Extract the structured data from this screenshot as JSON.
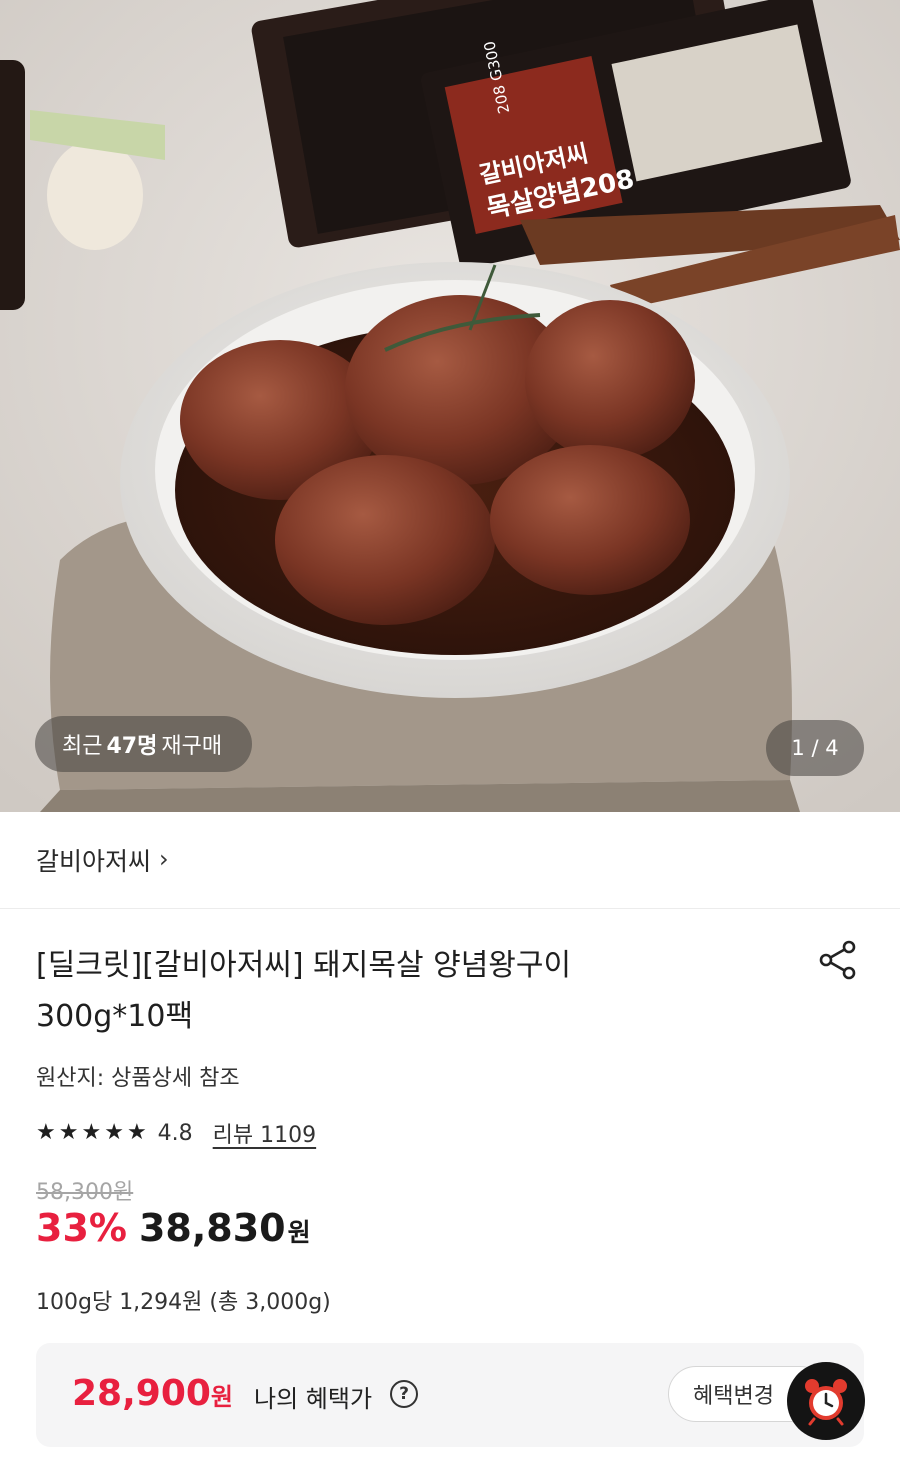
{
  "hero": {
    "image_name": "marinated pork neck on white plate",
    "package_label_1": "갈비아저씨",
    "package_label_2": "목살양념208",
    "package_badge": "208 G300",
    "repurchase": {
      "prefix": "최근",
      "count": "47명",
      "suffix": "재구매"
    },
    "counter": "1 / 4"
  },
  "store": {
    "name": "갈비아저씨",
    "chevron": "›"
  },
  "product": {
    "title_line1": "[딜크릿][갈비아저씨] 돼지목살 양념왕구이",
    "title_line2": "300g*10팩",
    "origin": "원산지: 상품상세 참조",
    "rating": "4.8",
    "stars": 5,
    "reviews": "리뷰 1109",
    "original_price": "58,300원",
    "discount": "33%",
    "sale_price": "38,830",
    "currency": "원",
    "unit_price": "100g당 1,294원 (총 3,000g)"
  },
  "benefit": {
    "price": "28,900",
    "currency": "원",
    "label": "나의 혜택가",
    "help": "?",
    "change_button": "혜택변경"
  },
  "icons": {
    "share": "share-icon",
    "star": "star-icon",
    "alarm": "alarm-clock-icon"
  },
  "colors": {
    "accent_red": "#e8203f",
    "benefit_bg": "#f5f5f6"
  }
}
